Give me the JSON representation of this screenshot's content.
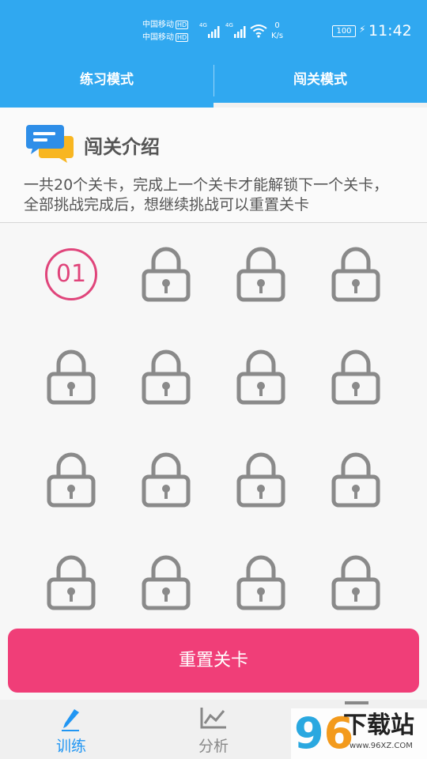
{
  "status_bar": {
    "carrier_1": "中国移动",
    "carrier_2": "中国移动",
    "hd": "HD",
    "net_1": "4G",
    "net_2": "4G",
    "speed_value": "0",
    "speed_unit": "K/s",
    "battery": "100",
    "time": "11:42"
  },
  "tabs": [
    {
      "label": "练习模式",
      "active": false
    },
    {
      "label": "闯关模式",
      "active": true
    }
  ],
  "intro": {
    "title": "闯关介绍",
    "description": "一共20个关卡，完成上一个关卡才能解锁下一个关卡，全部挑战完成后，想继续挑战可以重置关卡"
  },
  "levels": {
    "unlocked_label": "01",
    "total": 20,
    "visible": 16
  },
  "reset_button": {
    "label": "重置关卡"
  },
  "bottom_nav": [
    {
      "label": "训练",
      "icon": "pencil-icon",
      "active": true
    },
    {
      "label": "分析",
      "icon": "line-chart-icon",
      "active": false
    }
  ],
  "watermark": {
    "digits_a": "9",
    "digits_b": "6",
    "text": "下载站",
    "url": "www.96XZ.COM"
  },
  "colors": {
    "primary": "#30a8f0",
    "accent": "#f03e78",
    "lock": "#8a8a8a",
    "active_nav": "#2196f3"
  }
}
